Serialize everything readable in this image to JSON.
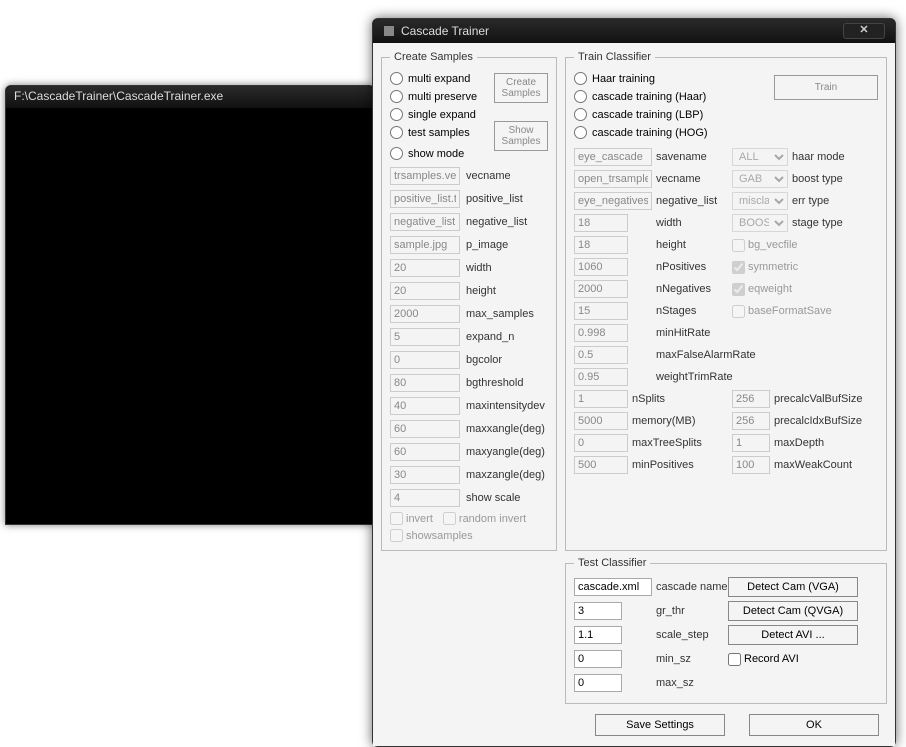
{
  "console": {
    "title": "F:\\CascadeTrainer\\CascadeTrainer.exe"
  },
  "dialog": {
    "title": "Cascade Trainer",
    "close": "✕",
    "create_samples": {
      "legend": "Create Samples",
      "radios": [
        "multi expand",
        "multi preserve",
        "single expand",
        "test samples",
        "show mode"
      ],
      "btn_create": "Create\nSamples",
      "btn_show": "Show\nSamples",
      "fields": {
        "vecname": {
          "value": "trsamples.vec",
          "label": "vecname"
        },
        "positive_list": {
          "value": "positive_list.txt",
          "label": "positive_list"
        },
        "negative_list": {
          "value": "negative_list.txt",
          "label": "negative_list"
        },
        "p_image": {
          "value": "sample.jpg",
          "label": "p_image"
        },
        "width": {
          "value": "20",
          "label": "width"
        },
        "height": {
          "value": "20",
          "label": "height"
        },
        "max_samples": {
          "value": "2000",
          "label": "max_samples"
        },
        "expand_n": {
          "value": "5",
          "label": "expand_n"
        },
        "bgcolor": {
          "value": "0",
          "label": "bgcolor"
        },
        "bgthreshold": {
          "value": "80",
          "label": "bgthreshold"
        },
        "maxintensitydev": {
          "value": "40",
          "label": "maxintensitydev"
        },
        "maxxangle": {
          "value": "60",
          "label": "maxxangle(deg)"
        },
        "maxyangle": {
          "value": "60",
          "label": "maxyangle(deg)"
        },
        "maxzangle": {
          "value": "30",
          "label": "maxzangle(deg)"
        },
        "show_scale": {
          "value": "4",
          "label": "show scale"
        }
      },
      "check_invert": "invert",
      "check_random_invert": "random invert",
      "check_showsamples": "showsamples"
    },
    "train_classifier": {
      "legend": "Train Classifier",
      "radios": [
        "Haar training",
        "cascade training (Haar)",
        "cascade training (LBP)",
        "cascade training (HOG)"
      ],
      "btn_train": "Train",
      "savename": {
        "value": "eye_cascade",
        "label": "savename"
      },
      "vecname": {
        "value": "open_trsamples",
        "label": "vecname"
      },
      "negative_list": {
        "value": "eye_negatives.",
        "label": "negative_list"
      },
      "haar_mode": {
        "value": "ALL",
        "label": "haar mode"
      },
      "boost_type": {
        "value": "GAB",
        "label": "boost type"
      },
      "err_type": {
        "value": "misclass",
        "label": "err type"
      },
      "stage_type": {
        "value": "BOOST",
        "label": "stage type"
      },
      "check_bg_vecfile": "bg_vecfile",
      "check_symmetric": "symmetric",
      "check_eqweight": "eqweight",
      "check_baseFormatSave": "baseFormatSave",
      "width": {
        "value": "18",
        "label": "width"
      },
      "height": {
        "value": "18",
        "label": "height"
      },
      "nPositives": {
        "value": "1060",
        "label": "nPositives"
      },
      "nNegatives": {
        "value": "2000",
        "label": "nNegatives"
      },
      "nStages": {
        "value": "15",
        "label": "nStages"
      },
      "minHitRate": {
        "value": "0.998",
        "label": "minHitRate"
      },
      "maxFalseAlarmRate": {
        "value": "0.5",
        "label": "maxFalseAlarmRate"
      },
      "weightTrimRate": {
        "value": "0.95",
        "label": "weightTrimRate"
      },
      "nSplits": {
        "value": "1",
        "label": "nSplits"
      },
      "memory": {
        "value": "5000",
        "label": "memory(MB)"
      },
      "maxTreeSplits": {
        "value": "0",
        "label": "maxTreeSplits"
      },
      "minPositives": {
        "value": "500",
        "label": "minPositives"
      },
      "precalcValBufSize": {
        "value": "256",
        "label": "precalcValBufSize"
      },
      "precalcIdxBufSize": {
        "value": "256",
        "label": "precalcIdxBufSize"
      },
      "maxDepth": {
        "value": "1",
        "label": "maxDepth"
      },
      "maxWeakCount": {
        "value": "100",
        "label": "maxWeakCount"
      }
    },
    "test_classifier": {
      "legend": "Test Classifier",
      "cascade_name": {
        "value": "cascade.xml",
        "label": "cascade name"
      },
      "gr_thr": {
        "value": "3",
        "label": "gr_thr"
      },
      "scale_step": {
        "value": "1.1",
        "label": "scale_step"
      },
      "min_sz": {
        "value": "0",
        "label": "min_sz"
      },
      "max_sz": {
        "value": "0",
        "label": "max_sz"
      },
      "btn_detect_vga": "Detect Cam (VGA)",
      "btn_detect_qvga": "Detect Cam (QVGA)",
      "btn_detect_avi": "Detect AVI ...",
      "check_record_avi": "Record AVI"
    },
    "btn_save_settings": "Save Settings",
    "btn_ok": "OK"
  }
}
